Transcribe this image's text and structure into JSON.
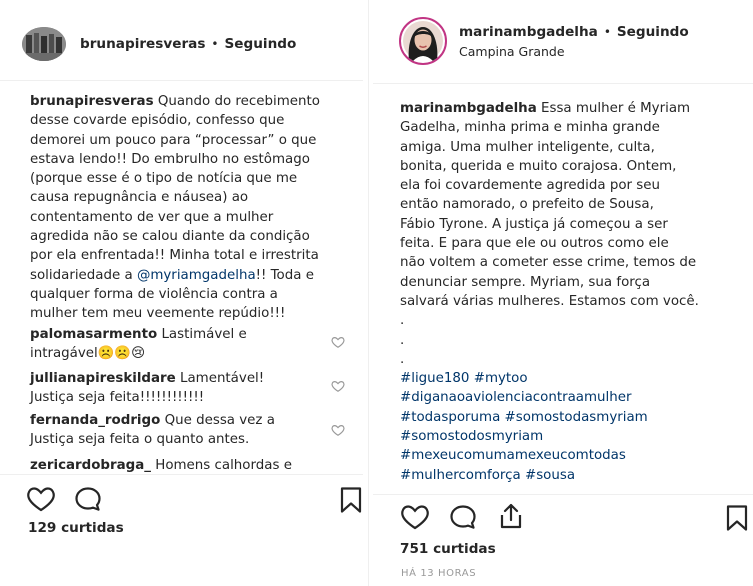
{
  "left_post": {
    "username": "brunapiresveras",
    "follow_separator": "•",
    "follow_label": "Seguindo",
    "caption": {
      "author": "brunapiresveras",
      "line1": "Quando do recebimento",
      "line2": "desse covarde episódio, confesso que",
      "line3": "demorei um pouco para “processar” o que",
      "line4": "estava lendo!! Do embrulho no estômago",
      "line5": "(porque esse é o tipo de notícia que me",
      "line6": "causa repugnância e náusea) ao",
      "line7": "contentamento de ver que a mulher",
      "line8": "agredida não se calou diante da condição",
      "line9": "por ela enfrentada!! Minha total e irrestrita",
      "line10_pre": "solidariedade a ",
      "line10_mention": "@myriamgadelha",
      "line10_post": "!! Toda e",
      "line11": "qualquer forma de violência contra a",
      "line12": "mulher tem meu veemente repúdio!!!"
    },
    "comments": [
      {
        "user": "palomasarmento",
        "text1": "Lastimável e",
        "text2": "intragável☹️☹️😢"
      },
      {
        "user": "jullianapireskildare",
        "text1": "Lamentável!",
        "text2": "Justiça seja feita!!!!!!!!!!!!"
      },
      {
        "user": "fernanda_rodrigo",
        "text1": "Que dessa vez a",
        "text2": "Justiça seja feita o quanto antes."
      },
      {
        "user": "zericardobraga_",
        "text1": "Homens calhordas e",
        "text2": ""
      }
    ],
    "likes": "129 curtidas"
  },
  "right_post": {
    "username": "marinambgadelha",
    "follow_separator": "•",
    "follow_label": "Seguindo",
    "location": "Campina Grande",
    "caption": {
      "author": "marinambgadelha",
      "line1": "Essa mulher é Myriam",
      "line2": "Gadelha, minha prima e minha grande",
      "line3": "amiga. Uma mulher inteligente, culta,",
      "line4": "bonita, querida e muito corajosa. Ontem,",
      "line5": "ela foi covardemente agredida por seu",
      "line6": "então namorado, o prefeito de Sousa,",
      "line7": "Fábio Tyrone. A justiça já começou a ser",
      "line8": "feita. E para que ele ou outros como ele",
      "line9": "não voltem a cometer esse crime, temos de",
      "line10": "denunciar sempre. Myriam, sua força",
      "line11": "salvará várias mulheres. Estamos com você.",
      "dot": "."
    },
    "hashtags": {
      "line1a": "#ligue180",
      "line1b": "#mytoo",
      "line2": "#diganaoaviolenciacontraamulher",
      "line3a": "#todasporuma",
      "line3b": "#somostodasmyriam",
      "line4": "#somostodosmyriam",
      "line5": "#mexeucomumamexeucomtodas",
      "line6a": "#mulhercomforça",
      "line6b": "#sousa"
    },
    "likes": "751 curtidas",
    "time": "HÁ 13 HORAS"
  },
  "icons": {
    "like": "heart-icon",
    "comment": "comment-icon",
    "share": "share-icon",
    "save": "bookmark-icon"
  }
}
